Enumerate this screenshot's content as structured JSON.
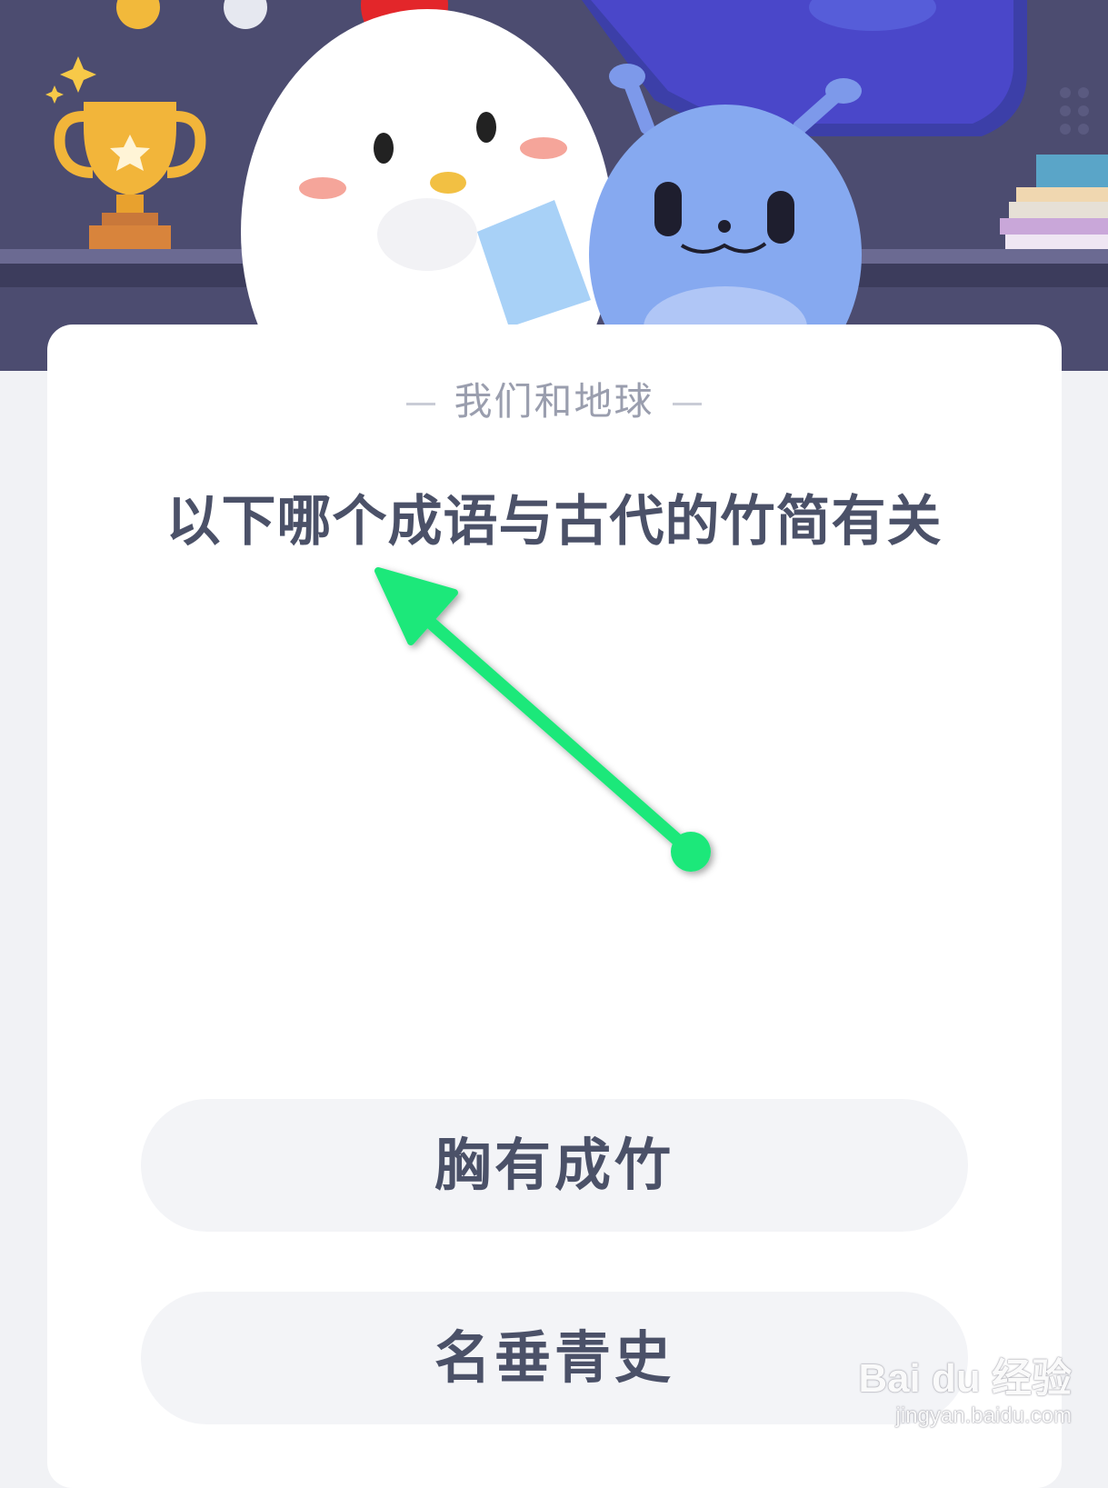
{
  "quiz": {
    "category": "我们和地球",
    "question": "以下哪个成语与古代的竹简有关",
    "options": [
      {
        "label": "胸有成竹"
      },
      {
        "label": "名垂青史"
      }
    ]
  },
  "watermark": {
    "brand": "Bai du 经验",
    "url": "jingyan.baidu.com"
  },
  "colors": {
    "banner_bg": "#4a4a6e",
    "card_bg": "#ffffff",
    "text_primary": "#4b5168",
    "text_secondary": "#9a9eae",
    "option_bg": "#f3f4f7",
    "arrow": "#1ee87a"
  },
  "icons": [
    "trophy-icon",
    "chick-mascot",
    "alien-mascot",
    "books-icon",
    "annotation-arrow"
  ]
}
